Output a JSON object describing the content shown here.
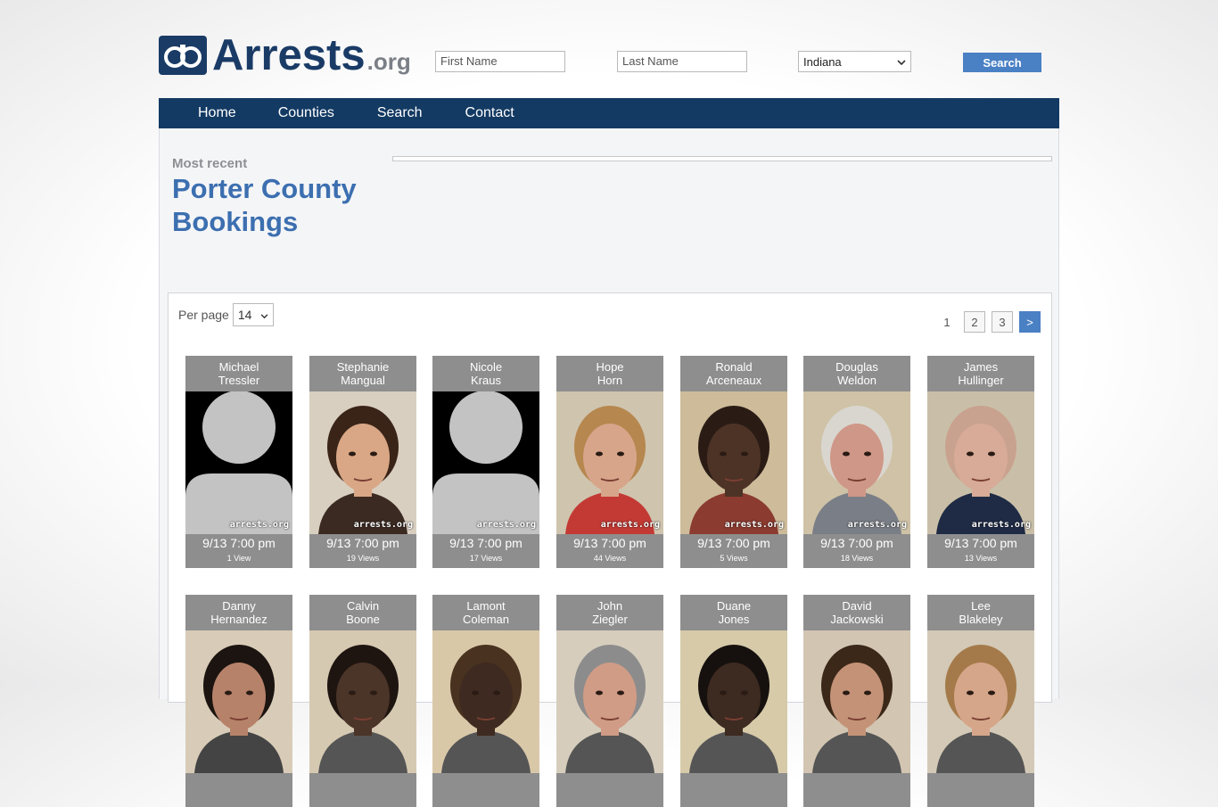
{
  "header": {
    "logo_text": "Arrests",
    "logo_suffix": ".org",
    "first_name_placeholder": "First Name",
    "last_name_placeholder": "Last Name",
    "state_value": "Indiana",
    "search_label": "Search"
  },
  "nav": {
    "items": [
      "Home",
      "Counties",
      "Search",
      "Contact"
    ]
  },
  "page": {
    "kicker": "Most recent",
    "title": "Porter County Bookings"
  },
  "listing": {
    "per_page_label": "Per page",
    "per_page_value": "14",
    "pages": [
      "1",
      "2",
      "3",
      ">"
    ],
    "watermark": "arrests.org",
    "bookings": [
      {
        "first": "Michael",
        "last": "Tressler",
        "time": "9/13 7:00 pm",
        "views": "1 View",
        "photo": "placeholder",
        "skin": "#c3c3c3",
        "hair": "#000000",
        "bg": "#000000",
        "shirt": "#c3c3c3"
      },
      {
        "first": "Stephanie",
        "last": "Mangual",
        "time": "9/13 7:00 pm",
        "views": "19 Views",
        "photo": "face",
        "skin": "#d9a786",
        "hair": "#3a2418",
        "bg": "#d8cfc0",
        "shirt": "#3b2a22"
      },
      {
        "first": "Nicole",
        "last": "Kraus",
        "time": "9/13 7:00 pm",
        "views": "17 Views",
        "photo": "placeholder",
        "skin": "#c3c3c3",
        "hair": "#000000",
        "bg": "#000000",
        "shirt": "#c3c3c3"
      },
      {
        "first": "Hope",
        "last": "Horn",
        "time": "9/13 7:00 pm",
        "views": "44 Views",
        "photo": "face",
        "skin": "#d7a58a",
        "hair": "#b6874e",
        "bg": "#cfc4ae",
        "shirt": "#c33a35"
      },
      {
        "first": "Ronald",
        "last": "Arceneaux",
        "time": "9/13 7:00 pm",
        "views": "5 Views",
        "photo": "face",
        "skin": "#4d3326",
        "hair": "#2a1c15",
        "bg": "#cdbb9a",
        "shirt": "#8b3b30"
      },
      {
        "first": "Douglas",
        "last": "Weldon",
        "time": "9/13 7:00 pm",
        "views": "18 Views",
        "photo": "face",
        "skin": "#cf9787",
        "hair": "#d9d6cf",
        "bg": "#cfc2a6",
        "shirt": "#7a7e86"
      },
      {
        "first": "James",
        "last": "Hullinger",
        "time": "9/13 7:00 pm",
        "views": "13 Views",
        "photo": "face",
        "skin": "#d7ab98",
        "hair": "#c9a28f",
        "bg": "#c9bfa8",
        "shirt": "#1f2b45"
      },
      {
        "first": "Danny",
        "last": "Hernandez",
        "time": "",
        "views": "",
        "photo": "face",
        "skin": "#b7826a",
        "hair": "#1b1410",
        "bg": "#d8ccb8",
        "shirt": "#444444"
      },
      {
        "first": "Calvin",
        "last": "Boone",
        "time": "",
        "views": "",
        "photo": "face",
        "skin": "#4b3428",
        "hair": "#1f1510",
        "bg": "#d6c9b2",
        "shirt": "#555555"
      },
      {
        "first": "Lamont",
        "last": "Coleman",
        "time": "",
        "views": "",
        "photo": "face",
        "skin": "#3e2a20",
        "hair": "#4a3220",
        "bg": "#d9c8a8",
        "shirt": "#555555"
      },
      {
        "first": "John",
        "last": "Ziegler",
        "time": "",
        "views": "",
        "photo": "face",
        "skin": "#d09c86",
        "hair": "#8c8c8c",
        "bg": "#d6cdbd",
        "shirt": "#555555"
      },
      {
        "first": "Duane",
        "last": "Jones",
        "time": "",
        "views": "",
        "photo": "face",
        "skin": "#3d2a21",
        "hair": "#16110e",
        "bg": "#d6caa9",
        "shirt": "#555555"
      },
      {
        "first": "David",
        "last": "Jackowski",
        "time": "",
        "views": "",
        "photo": "face",
        "skin": "#c49377",
        "hair": "#3b2819",
        "bg": "#d2c5b2",
        "shirt": "#555555"
      },
      {
        "first": "Lee",
        "last": "Blakeley",
        "time": "",
        "views": "",
        "photo": "face",
        "skin": "#d6a68a",
        "hair": "#a57a4a",
        "bg": "#d3c9b6",
        "shirt": "#555555"
      }
    ]
  }
}
